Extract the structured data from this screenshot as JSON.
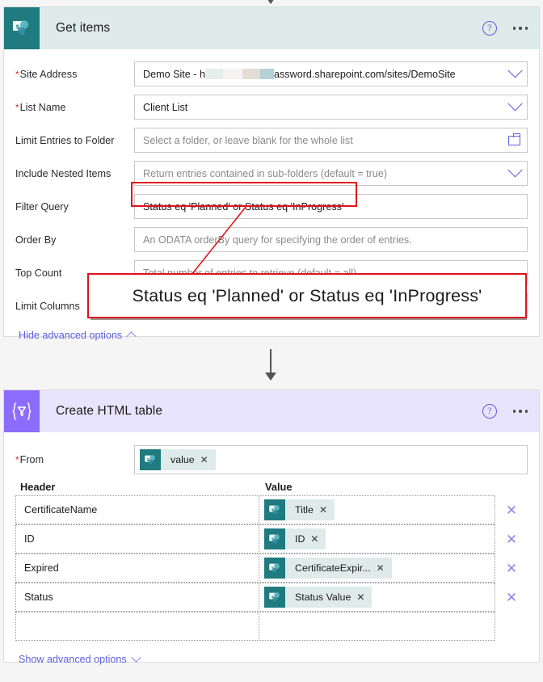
{
  "page": {
    "background": "#f5f5f5",
    "annotation_color": "#e1121c"
  },
  "top_connector": {
    "name": "flow-connector-top"
  },
  "get_items_card": {
    "icon": "sharepoint-icon",
    "icon_bg": "#1f7b80",
    "header_bg": "#dfeaea",
    "title": "Get items",
    "help_label": "?",
    "menu_label": "…",
    "fields": [
      {
        "label": "Site Address",
        "required": true,
        "value": "Demo Site - h",
        "value_suffix": "assword.sharepoint.com/sites/DemoSite",
        "redacted": true,
        "control": "dropdown"
      },
      {
        "label": "List Name",
        "required": true,
        "value": "Client List",
        "control": "dropdown"
      },
      {
        "label": "Limit Entries to Folder",
        "required": false,
        "placeholder": "Select a folder, or leave blank for the whole list",
        "control": "folder-picker"
      },
      {
        "label": "Include Nested Items",
        "required": false,
        "placeholder": "Return entries contained in sub-folders (default = true)",
        "control": "dropdown"
      },
      {
        "label": "Filter Query",
        "required": false,
        "value": "Status eq 'Planned'  or Status eq 'InProgress'",
        "control": "text",
        "highlighted": true
      },
      {
        "label": "Order By",
        "required": false,
        "placeholder": "An ODATA orderBy query for specifying the order of entries.",
        "control": "text"
      },
      {
        "label": "Top Count",
        "required": false,
        "placeholder": "Total number of entries to retrieve (default = all).",
        "control": "text"
      },
      {
        "label": "Limit Columns",
        "required": false,
        "placeholder": "",
        "control": "text"
      }
    ],
    "advanced_link": "Hide advanced options"
  },
  "callout": {
    "text": "Status eq 'Planned'  or Status eq 'InProgress'"
  },
  "mid_connector": {
    "name": "flow-connector-mid"
  },
  "create_html_table_card": {
    "icon": "data-operation-icon",
    "icon_bg": "#8c6cfa",
    "header_bg": "#e9e4fd",
    "title": "Create HTML table",
    "help_label": "?",
    "menu_label": "…",
    "from": {
      "label": "From",
      "required": true,
      "token": {
        "icon": "sharepoint-icon",
        "label": "value",
        "remove": "✕"
      }
    },
    "columns": {
      "header": "Header",
      "value": "Value"
    },
    "rows": [
      {
        "header": "CertificateName",
        "token": {
          "icon": "sharepoint-icon",
          "label": "Title",
          "remove": "✕"
        },
        "delete": "✕"
      },
      {
        "header": "ID",
        "token": {
          "icon": "sharepoint-icon",
          "label": "ID",
          "remove": "✕"
        },
        "delete": "✕"
      },
      {
        "header": "Expired",
        "token": {
          "icon": "sharepoint-icon",
          "label": "CertificateExpir...",
          "remove": "✕"
        },
        "delete": "✕"
      },
      {
        "header": "Status",
        "token": {
          "icon": "sharepoint-icon",
          "label": "Status Value",
          "remove": "✕"
        },
        "delete": "✕"
      },
      {
        "header": "",
        "token": null,
        "delete": ""
      }
    ],
    "advanced_link": "Show advanced options"
  }
}
